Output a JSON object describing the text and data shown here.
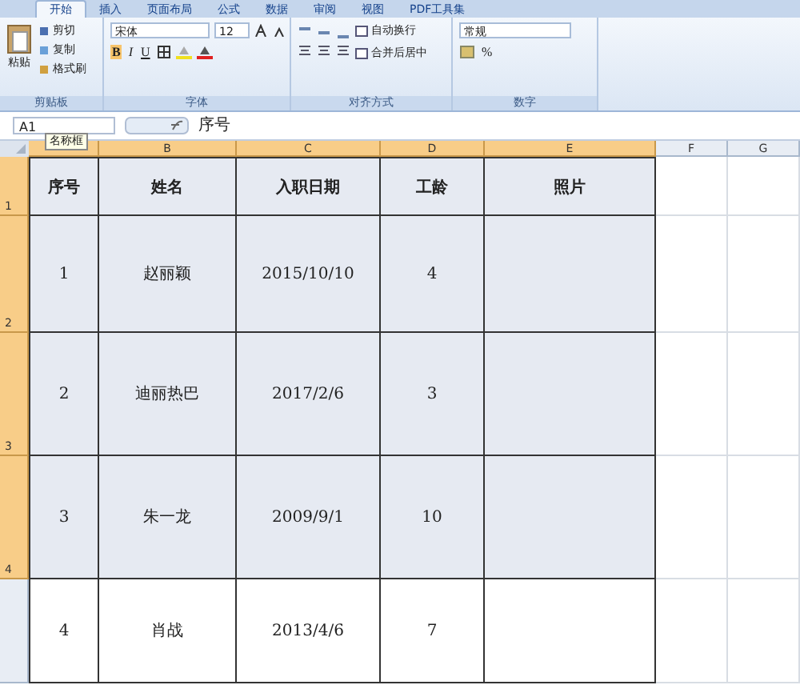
{
  "ribbon_tabs": [
    {
      "label": "开始",
      "selected": true
    },
    {
      "label": "插入",
      "selected": false
    },
    {
      "label": "页面布局",
      "selected": false
    },
    {
      "label": "公式",
      "selected": false
    },
    {
      "label": "数据",
      "selected": false
    },
    {
      "label": "审阅",
      "selected": false
    },
    {
      "label": "视图",
      "selected": false
    },
    {
      "label": "PDF工具集",
      "selected": false
    }
  ],
  "ribbon_groups": [
    {
      "label": "剪贴板",
      "controls": [
        {
          "kind": "paste",
          "label": "粘贴"
        },
        {
          "kind": "stack",
          "items": [
            "剪切",
            "复制",
            "格式刷"
          ]
        }
      ]
    },
    {
      "label": "字体",
      "controls": [
        {
          "kind": "font",
          "font": "宋体",
          "size": "12",
          "glyphs": [
            "B",
            "I",
            "U"
          ]
        }
      ]
    },
    {
      "label": "对齐方式",
      "controls": [
        {
          "kind": "align",
          "items": [
            "自动换行",
            "合并后居中"
          ]
        }
      ]
    },
    {
      "label": "数字",
      "controls": [
        {
          "kind": "number",
          "format": "常规",
          "glyphs": [
            "%"
          ]
        }
      ]
    }
  ],
  "formula_bar": {
    "name_box": "A1",
    "tooltip": "名称框",
    "formula": "序号"
  },
  "columns": [
    {
      "selected": true
    },
    {
      "label": "B",
      "selected": true
    },
    {
      "label": "C",
      "selected": true
    },
    {
      "label": "D",
      "selected": true
    },
    {
      "label": "E",
      "selected": true
    },
    {
      "label": "F",
      "selected": false
    },
    {
      "label": "G",
      "selected": false
    }
  ],
  "rows": [
    {
      "number": "1",
      "selected": true,
      "cells": [
        "序号",
        "姓名",
        "入职日期",
        "工龄",
        "照片"
      ]
    },
    {
      "number": "2",
      "selected": true,
      "cells": [
        "1",
        "赵丽颖",
        "2015/10/10",
        "4",
        ""
      ]
    },
    {
      "number": "3",
      "selected": true,
      "cells": [
        "2",
        "迪丽热巴",
        "2017/2/6",
        "3",
        ""
      ]
    },
    {
      "number": "4",
      "selected": true,
      "cells": [
        "3",
        "朱一龙",
        "2009/9/1",
        "10",
        ""
      ]
    },
    {
      "selected": false,
      "cells": [
        "4",
        "肖战",
        "2013/4/6",
        "7",
        ""
      ]
    }
  ]
}
